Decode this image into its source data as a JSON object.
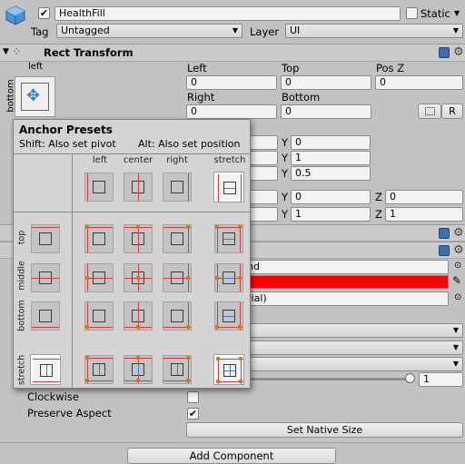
{
  "object": {
    "name": "HealthFill",
    "static_label": "Static",
    "tag_label": "Tag",
    "tag_value": "Untagged",
    "layer_label": "Layer",
    "layer_value": "UI"
  },
  "rect_transform": {
    "title": "Rect Transform",
    "anchor_h": "left",
    "anchor_v": "bottom",
    "left_label": "Left",
    "left_value": "0",
    "top_label": "Top",
    "top_value": "0",
    "posz_label": "Pos Z",
    "posz_value": "0",
    "right_label": "Right",
    "right_value": "0",
    "bottom_label": "Bottom",
    "bottom_value": "0",
    "r_button": "R",
    "row1": {
      "y_label": "Y",
      "y_value": "0"
    },
    "row2": {
      "y_label": "Y",
      "y_value": "1"
    },
    "row3": {
      "y_label": "Y",
      "y_value": "0.5"
    },
    "row4": {
      "y_label": "Y",
      "y_value": "0",
      "z_label": "Z",
      "z_value": "0"
    },
    "row5": {
      "y_label": "Y",
      "y_value": "1",
      "z_label": "Z",
      "z_value": "1"
    }
  },
  "anchor_presets": {
    "title": "Anchor Presets",
    "shift_hint": "Shift: Also set pivot",
    "alt_hint": "Alt: Also set position",
    "columns": [
      "left",
      "center",
      "right",
      "stretch"
    ],
    "rows": [
      "top",
      "middle",
      "bottom",
      "stretch"
    ]
  },
  "image": {
    "source_partial": "nd",
    "material_partial": "rial)",
    "color_hex": "#ff0000",
    "fill_amount": "1",
    "fill_fraction": 1.0,
    "clockwise_label": "Clockwise",
    "clockwise_checked": false,
    "preserve_label": "Preserve Aspect",
    "preserve_checked": true,
    "check_glyph": "✔",
    "set_native_size": "Set Native Size"
  },
  "add_component": "Add Component",
  "colors": {
    "accent_red": "#ff0000",
    "anchor_red": "#d63b3b",
    "anchor_blue": "#3a7bd5"
  }
}
